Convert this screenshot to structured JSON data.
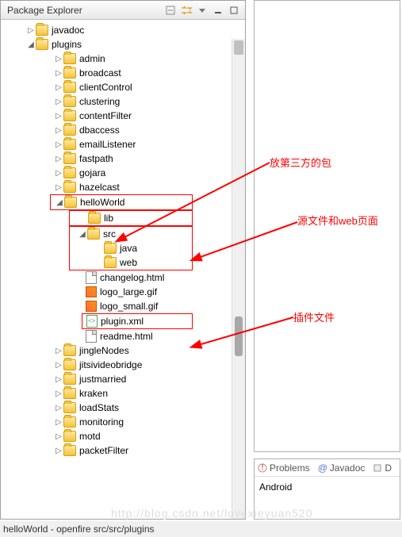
{
  "panel_title": "Package Explorer",
  "tree": {
    "javadoc": "javadoc",
    "plugins": "plugins",
    "items": [
      "admin",
      "broadcast",
      "clientControl",
      "clustering",
      "contentFilter",
      "dbaccess",
      "emailListener",
      "fastpath",
      "gojara",
      "hazelcast"
    ],
    "helloWorld": "helloWorld",
    "lib": "lib",
    "src": "src",
    "java": "java",
    "web": "web",
    "files": {
      "changelog": "changelog.html",
      "logo_large": "logo_large.gif",
      "logo_small": "logo_small.gif",
      "plugin_xml": "plugin.xml",
      "readme": "readme.html"
    },
    "after": [
      "jingleNodes",
      "jitsivideobridge",
      "justmarried",
      "kraken",
      "loadStats",
      "monitoring",
      "motd",
      "packetFilter"
    ]
  },
  "annotations": {
    "a1": "放第三方的包",
    "a2": "源文件和web页面",
    "a3": "插件文件"
  },
  "tabs": {
    "problems": "Problems",
    "javadoc": "Javadoc",
    "d": "D"
  },
  "bottom_content": "Android",
  "status": "helloWorld - openfire src/src/plugins",
  "watermark": "http://blog.csdn.net/lovexieyuan520"
}
